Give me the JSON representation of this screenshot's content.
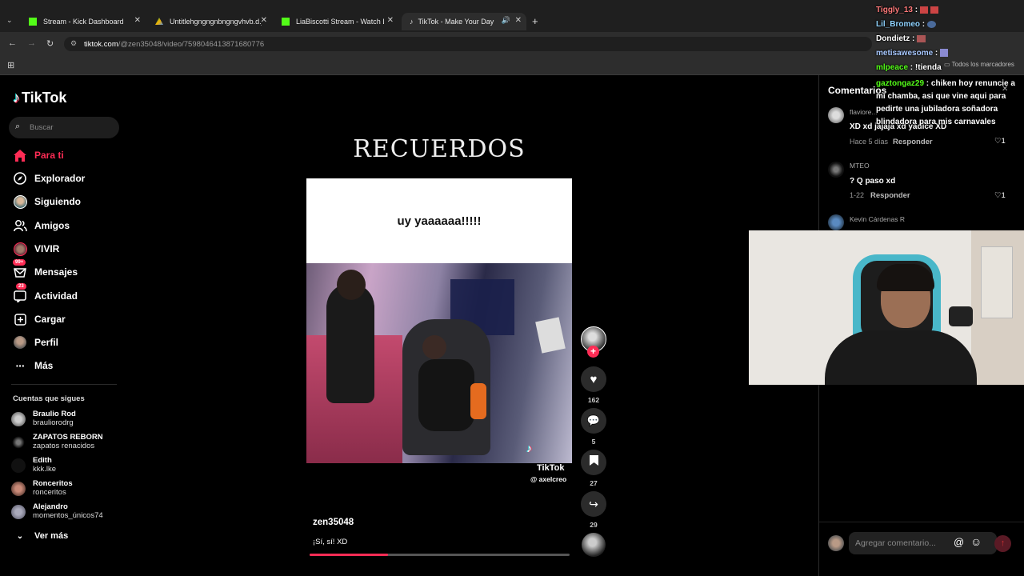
{
  "browser": {
    "tabs": [
      {
        "title": "Stream - Kick Dashboard",
        "icon": "kick-icon",
        "color": "#53fc18"
      },
      {
        "title": "Untitlehgngngnbngngvhvb.d.jpg",
        "icon": "drive-icon",
        "color": "#f4b400"
      },
      {
        "title": "LiaBiscotti Stream - Watch Live",
        "icon": "kick-icon",
        "color": "#53fc18"
      },
      {
        "title": "TikTok - Make Your Day",
        "icon": "tiktok-icon",
        "color": "#ffffff"
      }
    ],
    "url_host": "tiktok.com",
    "url_path": "/@zen35048/video/7598046413871680776",
    "bookmarks_label": "Todos los marcadores"
  },
  "tiktok": {
    "logo": "TikTok",
    "search_placeholder": "Buscar",
    "nav": [
      {
        "label": "Para ti",
        "icon": "home-icon",
        "active": true
      },
      {
        "label": "Explorador",
        "icon": "compass-icon"
      },
      {
        "label": "Siguiendo",
        "icon": "following-avatar-icon"
      },
      {
        "label": "Amigos",
        "icon": "friends-icon"
      },
      {
        "label": "VIVIR",
        "icon": "live-icon"
      },
      {
        "label": "Mensajes",
        "icon": "message-icon",
        "badge": "99+"
      },
      {
        "label": "Actividad",
        "icon": "activity-icon",
        "badge": "23"
      },
      {
        "label": "Cargar",
        "icon": "upload-icon"
      },
      {
        "label": "Perfil",
        "icon": "profile-avatar-icon"
      },
      {
        "label": "Más",
        "icon": "more-icon"
      }
    ],
    "following_title": "Cuentas que sigues",
    "following": [
      {
        "name": "Braulio Rod",
        "handle": "brauliorodrg"
      },
      {
        "name": "ZAPATOS REBORN",
        "handle": "zapatos renacidos"
      },
      {
        "name": "Edith",
        "handle": "kkk.lke"
      },
      {
        "name": "Ronceritos",
        "handle": "ronceritos"
      },
      {
        "name": "Alejandro",
        "handle": "momentos_únicos74"
      }
    ],
    "see_more": "Ver más"
  },
  "video": {
    "overlay_title": "RECUERDOS",
    "caption_text": "uy yaaaaaa!!!!!",
    "watermark": "TikTok",
    "watermark_handle": "@ axelcreo",
    "author": "zen35048",
    "description": "¡Sí, sí! XD",
    "progress": 0.3,
    "likes": "162",
    "comments": "5",
    "saves": "27",
    "shares": "29"
  },
  "comments_panel": {
    "title": "Comentarios",
    "items": [
      {
        "user": "flaviore...",
        "text": "XD xd jajaja xd yadice XD",
        "time": "Hace 5 días",
        "reply": "Responder",
        "likes": "1"
      },
      {
        "user": "MTEO",
        "text": "? Q paso xd",
        "time": "1-22",
        "reply": "Responder",
        "likes": "1"
      },
      {
        "user": "Kevin Cárdenas R",
        "text": "",
        "time": "",
        "reply": "",
        "likes": ""
      }
    ],
    "input_placeholder": "Agregar comentario..."
  },
  "stream_chat": [
    {
      "user": "Tiggly_13",
      "color": "#ff7a7a",
      "msg": ""
    },
    {
      "user": "Lil_Bromeo",
      "color": "#8fd3ff",
      "msg": ""
    },
    {
      "user": "Dondietz",
      "color": "#ffffff",
      "msg": ""
    },
    {
      "user": "metisawesome",
      "color": "#a8c8ff",
      "msg": ""
    },
    {
      "user": "mlpeace",
      "color": "#53fc18",
      "msg": "!tienda"
    },
    {
      "user": "gaztongaz29",
      "color": "#53fc18",
      "msg": "chiken hoy renuncie a mi chamba, asi que vine aqui para pedirte una jubiladora soñadora blindadora para mis carnavales"
    }
  ]
}
